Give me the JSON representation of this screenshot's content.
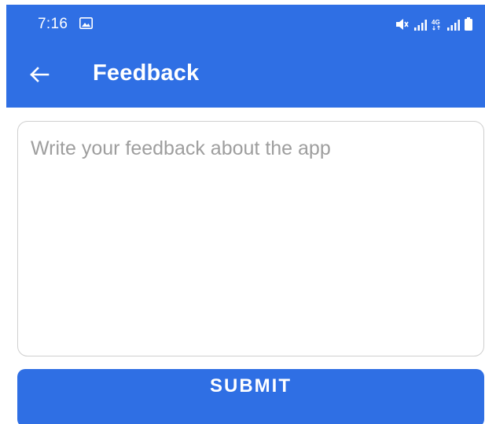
{
  "status_bar": {
    "time": "7:16",
    "icons": [
      "gallery-icon",
      "mute-icon",
      "signal-icon",
      "4g-icon",
      "signal-icon",
      "battery-icon"
    ],
    "network_label": "4G"
  },
  "app_bar": {
    "title": "Feedback",
    "back_icon": "arrow-left-icon"
  },
  "feedback": {
    "value": "",
    "placeholder": "Write your feedback about the app"
  },
  "submit": {
    "label": "SUBMIT"
  },
  "colors": {
    "primary": "#2f6fe4",
    "on_primary": "#ffffff",
    "border": "#cfcfcf",
    "placeholder": "#9e9e9e",
    "background": "#ffffff"
  }
}
